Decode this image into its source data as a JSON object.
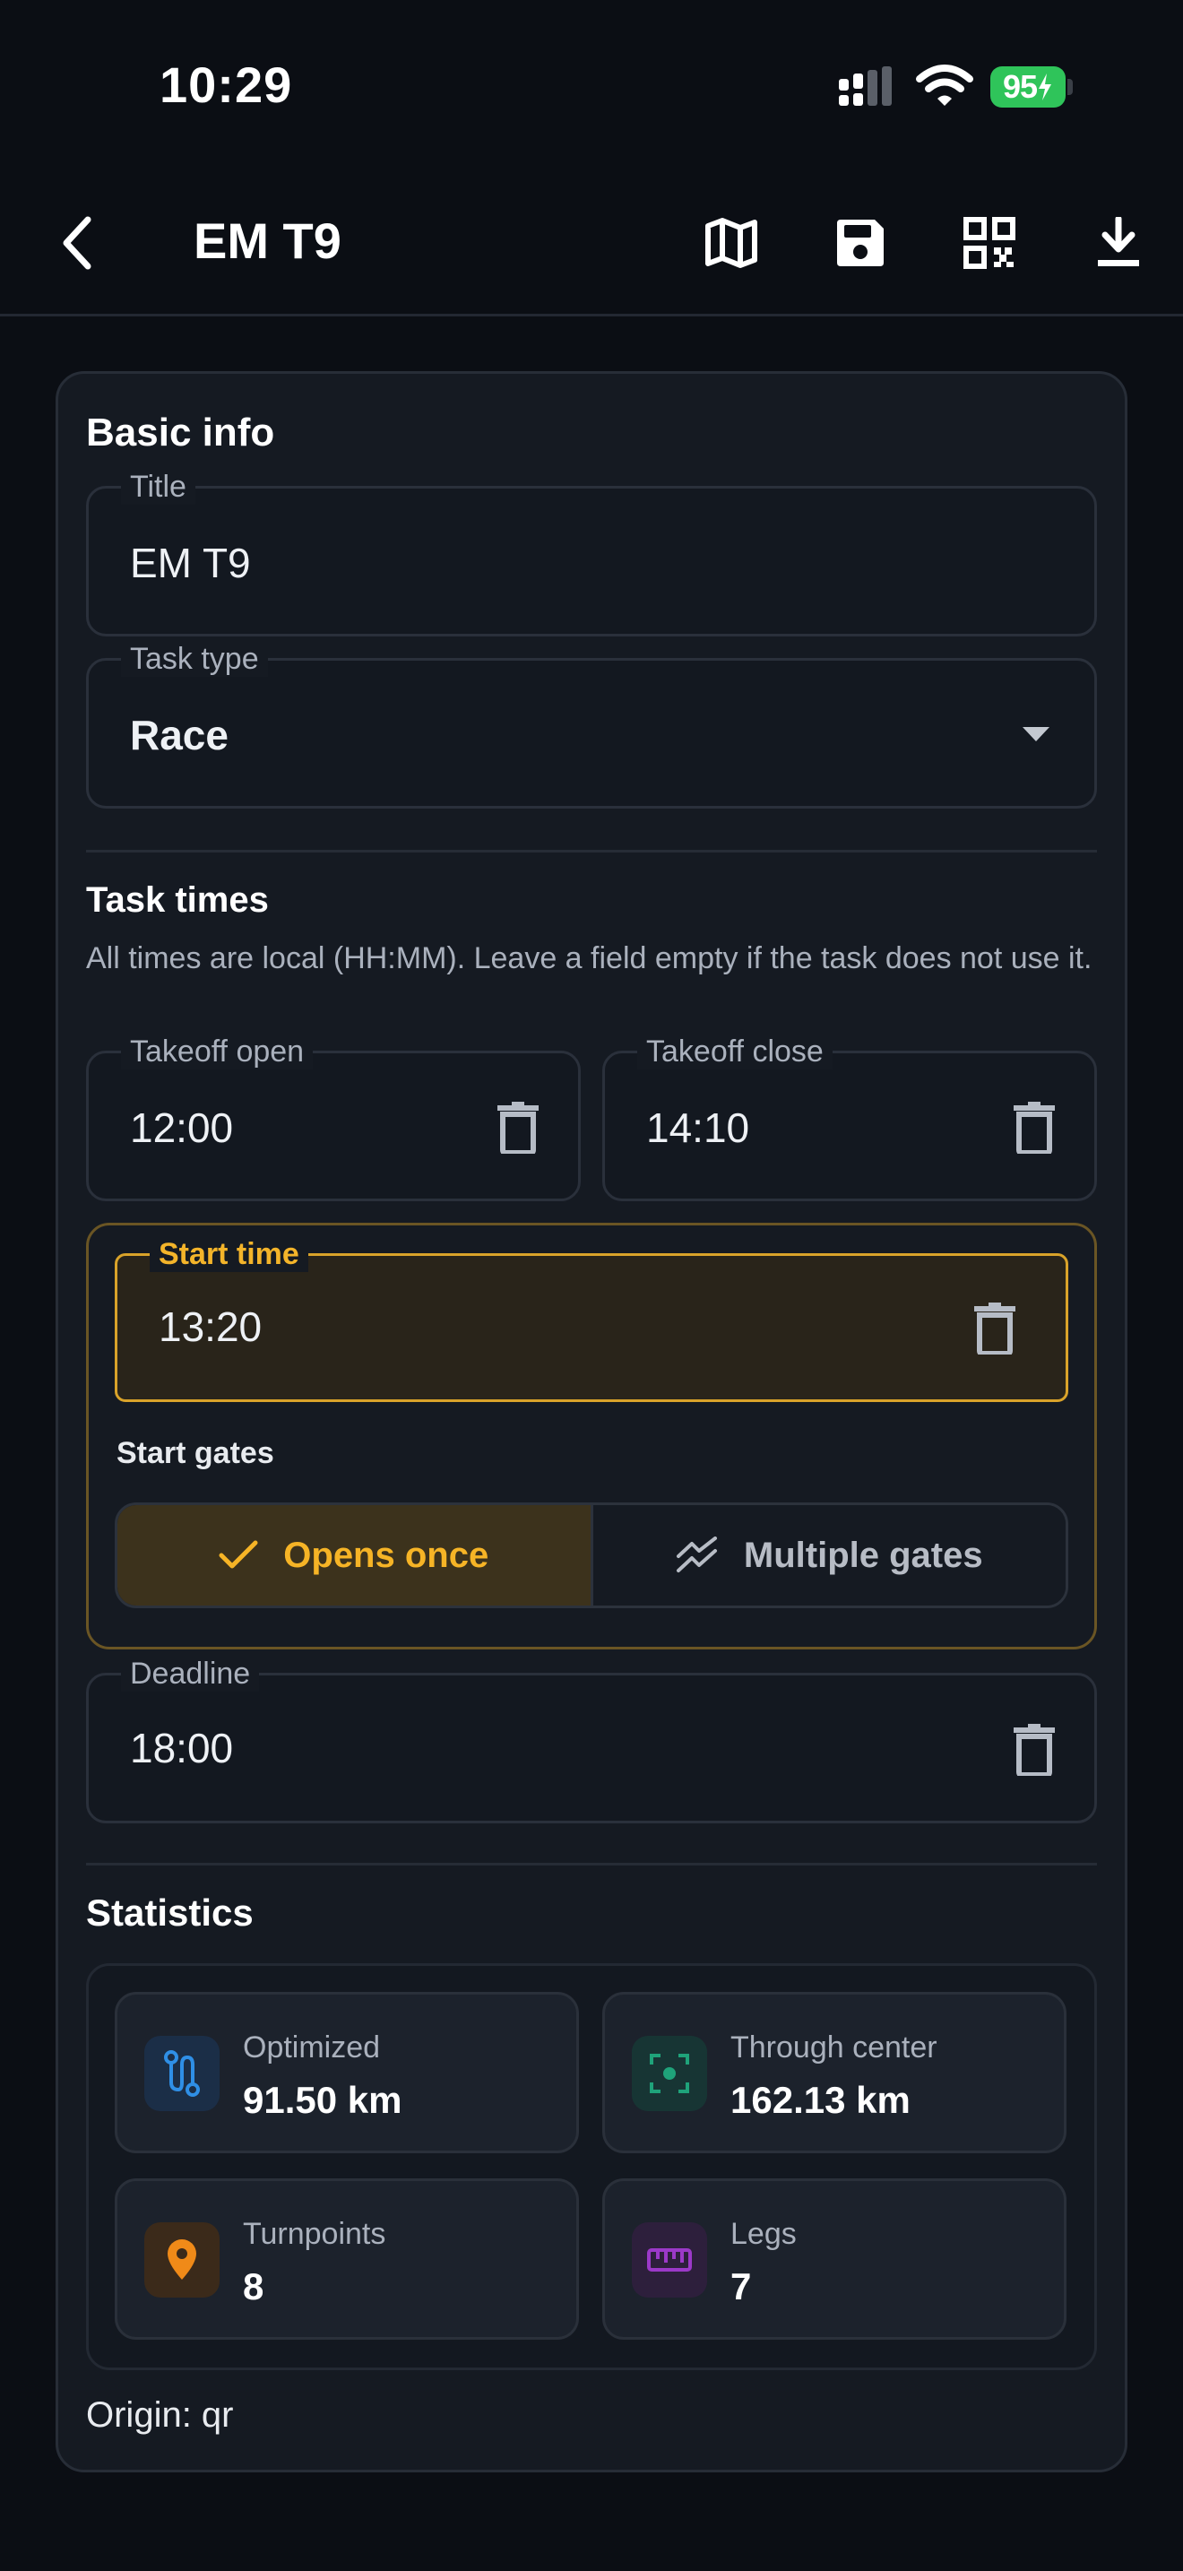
{
  "status_bar": {
    "time": "10:29",
    "battery": "95"
  },
  "app_bar": {
    "title": "EM T9",
    "icons": [
      "back-arrow-icon",
      "map-icon",
      "save-icon",
      "qr-code-icon",
      "download-icon"
    ]
  },
  "basic_info": {
    "heading": "Basic info",
    "title_label": "Title",
    "title_value": "EM T9",
    "task_type_label": "Task type",
    "task_type_value": "Race"
  },
  "task_times": {
    "heading": "Task times",
    "description": "All times are local (HH:MM). Leave a field empty if the task does not use it.",
    "takeoff_open_label": "Takeoff open",
    "takeoff_open_value": "12:00",
    "takeoff_close_label": "Takeoff close",
    "takeoff_close_value": "14:10",
    "start_time_label": "Start time",
    "start_time_value": "13:20",
    "start_gates_label": "Start gates",
    "start_gates_options": [
      "Opens once",
      "Multiple gates"
    ],
    "start_gates_selected": "Opens once",
    "deadline_label": "Deadline",
    "deadline_value": "18:00"
  },
  "statistics": {
    "heading": "Statistics",
    "items": [
      {
        "label": "Optimized",
        "value": "91.50 km",
        "icon": "route-icon",
        "color": "#2f8fe6"
      },
      {
        "label": "Through center",
        "value": "162.13 km",
        "icon": "center-focus-icon",
        "color": "#1fa37a"
      },
      {
        "label": "Turnpoints",
        "value": "8",
        "icon": "location-pin-icon",
        "color": "#f08a18"
      },
      {
        "label": "Legs",
        "value": "7",
        "icon": "ruler-icon",
        "color": "#9b39c8"
      }
    ]
  },
  "origin": "Origin: qr",
  "colors": {
    "accent": "#f6b426",
    "background": "#0b0e14",
    "card": "#151a22"
  }
}
